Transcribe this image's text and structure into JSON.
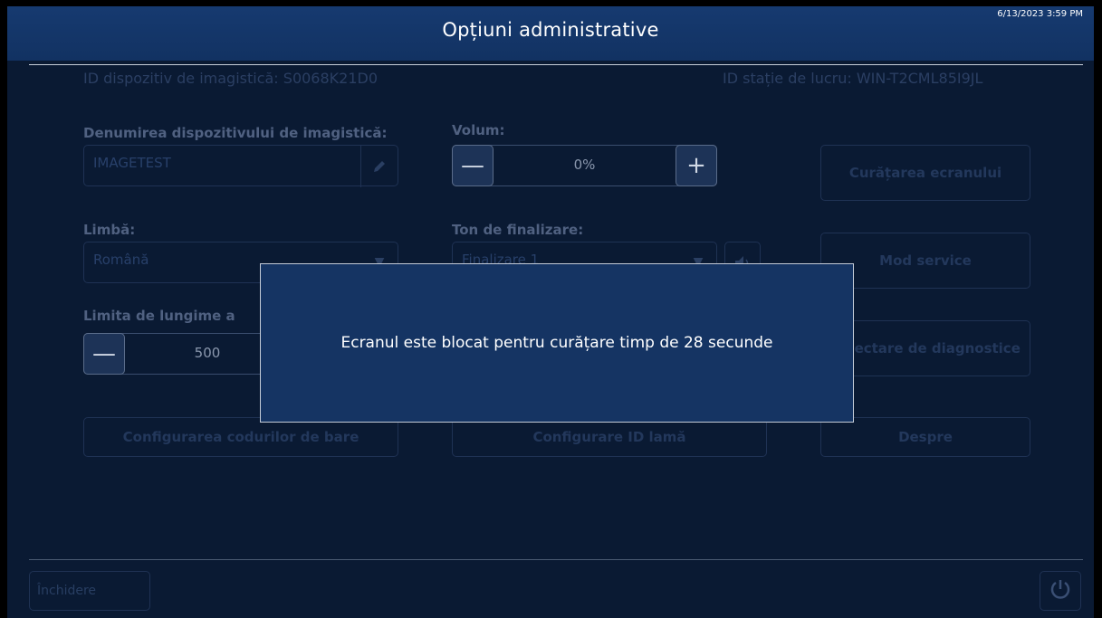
{
  "header": {
    "title": "Opțiuni administrative",
    "datetime": "6/13/2023 3:59 PM"
  },
  "device_id": "ID dispozitiv de imagistică: S0068K21D0",
  "workstation_id": "ID stație de lucru: WIN-T2CML85I9JL",
  "device_name": {
    "label": "Denumirea dispozitivului de imagistică:",
    "value": "IMAGETEST",
    "icon": "pencil-icon"
  },
  "volume": {
    "label": "Volum:",
    "value": "0%",
    "minus": "—",
    "plus": "+"
  },
  "language": {
    "label": "Limbă:",
    "value": "Română",
    "icon": "chevron-down-icon"
  },
  "completion_tone": {
    "label": "Ton de finalizare:",
    "value": "Finalizare 1",
    "icon": "speaker-icon"
  },
  "length_limit": {
    "label": "Limita de lungime a",
    "value": "500",
    "minus": "—"
  },
  "buttons": {
    "screen_clean": "Curățarea ecranului",
    "service_mode": "Mod service",
    "diagnostics": "Colectare de diagnostice",
    "barcode_config": "Configurarea codurilor de bare",
    "slide_id_config": "Configurare ID lamă",
    "about": "Despre"
  },
  "modal": {
    "message": "Ecranul este blocat pentru curățare timp de 28 secunde"
  },
  "footer": {
    "close_label": "Închidere",
    "power_icon": "power-icon"
  },
  "colors": {
    "background": "#0a1a33",
    "header": "#163a70",
    "modal": "#153463"
  }
}
